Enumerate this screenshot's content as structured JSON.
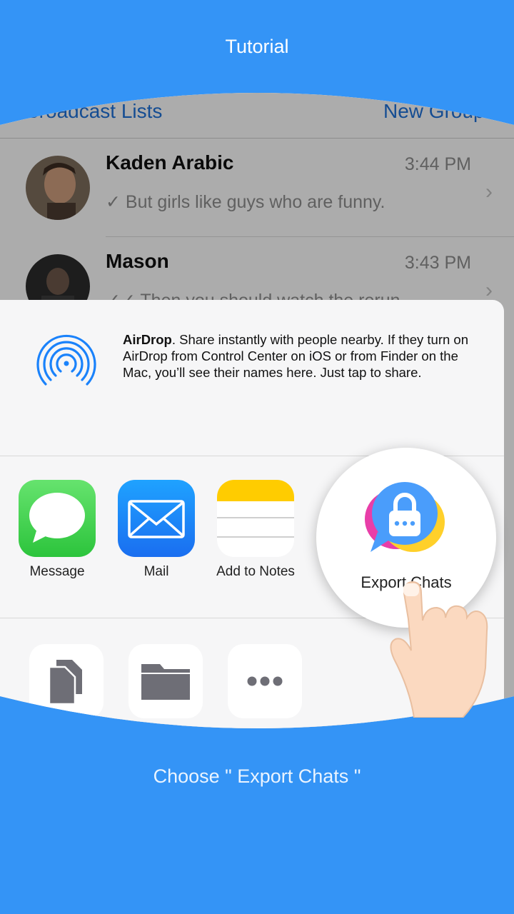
{
  "header": {
    "title": "Tutorial"
  },
  "caption": "Choose \" Export Chats \"",
  "nav": {
    "left": "Broadcast Lists",
    "right": "New Group"
  },
  "chats": [
    {
      "name": "Kaden Arabic",
      "time": "3:44 PM",
      "message": "✓ But girls like guys who are funny."
    },
    {
      "name": "Mason",
      "time": "3:43 PM",
      "message": "✓✓ Then you should watch the rerun"
    }
  ],
  "airdrop": {
    "title": "AirDrop",
    "text": ". Share instantly with people nearby. If they turn on AirDrop from Control Center on iOS or from Finder on the Mac, you’ll see their names here. Just tap to share."
  },
  "apps": [
    {
      "label": "Message",
      "icon": "message-icon"
    },
    {
      "label": "Mail",
      "icon": "mail-icon"
    },
    {
      "label": "Add to Notes",
      "icon": "notes-icon"
    }
  ],
  "export": {
    "label": "Export Chats",
    "icon": "lock-chat-icon"
  },
  "actions": [
    {
      "icon": "copy-icon"
    },
    {
      "icon": "folder-icon"
    },
    {
      "icon": "more-icon"
    }
  ],
  "colors": {
    "brand": "#3494f6",
    "link": "#1e6ed1",
    "message_green": "#4cd964",
    "mail_blue": "#1a82fb",
    "notes_yellow": "#ffcc00"
  }
}
